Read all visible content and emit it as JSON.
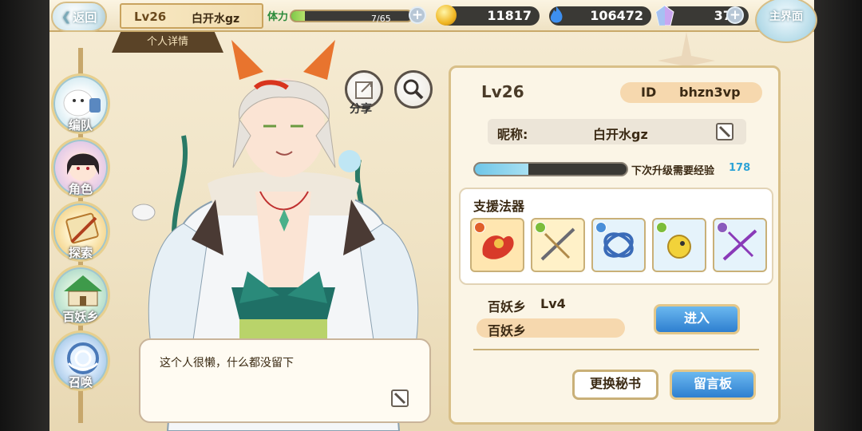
{
  "header": {
    "back_label": "返回",
    "level": "Lv26",
    "player_name": "白开水gz",
    "tab_title": "个人详情",
    "stamina_label": "体力",
    "stamina_value": "7/65",
    "stamina_fraction": 0.11,
    "gold": "11817",
    "soul": "106472",
    "crystal": "373",
    "home_label": "主界面"
  },
  "side_nav": [
    {
      "label": "编队",
      "icon": "team-icon"
    },
    {
      "label": "角色",
      "icon": "character-icon"
    },
    {
      "label": "探索",
      "icon": "explore-icon"
    },
    {
      "label": "百妖乡",
      "icon": "village-icon"
    },
    {
      "label": "召唤",
      "icon": "summon-icon"
    }
  ],
  "character": {
    "share_label": "分享",
    "bio": "这个人很懒，什么都没留下"
  },
  "panel": {
    "level": "Lv26",
    "id_label": "ID",
    "id_value": "bhzn3vp",
    "nick_label": "昵称:",
    "nick_value": "白开水gz",
    "exp_label": "下次升级需要经验",
    "exp_value": "178",
    "exp_fraction": 0.35,
    "support_title": "支援法器",
    "artifacts": [
      {
        "name": "fire-serpent-artifact-icon",
        "element": "#e0602a",
        "bg": "#ffe6b0"
      },
      {
        "name": "wind-crossbow-artifact-icon",
        "element": "#7cbd3a",
        "bg": "#fff1c8"
      },
      {
        "name": "water-ribbon-artifact-icon",
        "element": "#4a8fd8",
        "bg": "#e5f3fb"
      },
      {
        "name": "wind-bell-artifact-icon",
        "element": "#7cbd3a",
        "bg": "#e5f3fb"
      },
      {
        "name": "shadow-crossbow-artifact-icon",
        "element": "#8a5bbd",
        "bg": "#e5f3fb"
      }
    ],
    "village_name": "百妖乡",
    "village_level": "Lv4",
    "village_pill": "百妖乡",
    "enter_label": "进入",
    "secretary_label": "更换秘书",
    "message_label": "留言板"
  }
}
